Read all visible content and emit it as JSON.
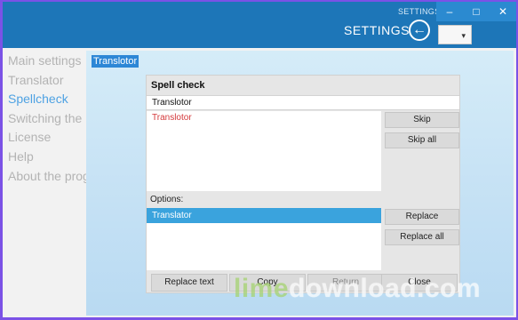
{
  "window": {
    "caption": "SETTINGS",
    "minimize_glyph": "–",
    "maximize_glyph": "□",
    "close_glyph": "✕"
  },
  "header": {
    "title": "SETTINGS",
    "back_icon_glyph": "←",
    "dropdown_chevron": "▾"
  },
  "nav": {
    "items": [
      {
        "label": "Main settings"
      },
      {
        "label": "Translator"
      },
      {
        "label": "Spellcheck"
      },
      {
        "label": "Switching the l"
      },
      {
        "label": "License"
      },
      {
        "label": "Help"
      },
      {
        "label": "About the prog"
      }
    ],
    "active_index": 2
  },
  "selection": {
    "word": "Translotor"
  },
  "dialog": {
    "title": "Spell check",
    "word_value": "Translotor",
    "context_text": "Translotor",
    "buttons": {
      "skip": "Skip",
      "skip_all": "Skip all",
      "replace": "Replace",
      "replace_all": "Replace all",
      "replace_text": "Replace text",
      "copy": "Copy",
      "return": "Return",
      "close": "Close"
    },
    "options_label": "Options:",
    "suggestions": [
      "Translator"
    ]
  },
  "watermark": {
    "part1": "lime",
    "part2": "download.com"
  },
  "colors": {
    "header": "#1d76b8",
    "active_nav": "#4ea2e3",
    "misspelled": "#d4393b",
    "selection": "#3aa3dd",
    "desktop": "#7b52e6"
  }
}
